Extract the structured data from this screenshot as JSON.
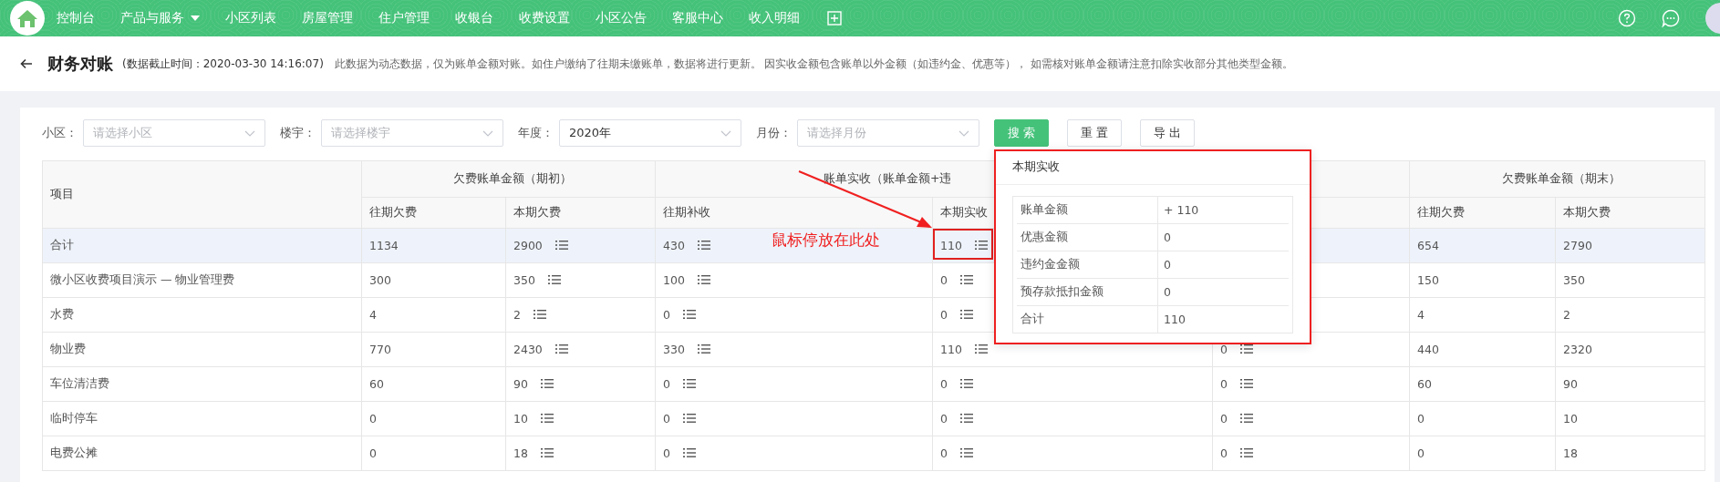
{
  "nav": {
    "items": [
      {
        "label": "控制台",
        "dropdown": false
      },
      {
        "label": "产品与服务",
        "dropdown": true
      },
      {
        "label": "小区列表",
        "dropdown": false
      },
      {
        "label": "房屋管理",
        "dropdown": false
      },
      {
        "label": "住户管理",
        "dropdown": false
      },
      {
        "label": "收银台",
        "dropdown": false
      },
      {
        "label": "收费设置",
        "dropdown": false
      },
      {
        "label": "小区公告",
        "dropdown": false
      },
      {
        "label": "客服中心",
        "dropdown": false
      },
      {
        "label": "收入明细",
        "dropdown": false
      }
    ]
  },
  "header": {
    "title": "财务对账",
    "timestamp": "(数据截止时间：2020-03-30 14:16:07)",
    "note": "此数据为动态数据，仅为账单金额对账。如住户缴纳了往期未缴账单，数据将进行更新。 因实收金额包含账单以外金额（如违约金、优惠等）， 如需核对账单金额请注意扣除实收部分其他类型金额。"
  },
  "filters": [
    {
      "label": "小区：",
      "placeholder": "请选择小区"
    },
    {
      "label": "楼宇：",
      "placeholder": "请选择楼宇"
    },
    {
      "label": "年度：",
      "value": "2020年"
    },
    {
      "label": "月份：",
      "placeholder": "请选择月份"
    }
  ],
  "buttons": [
    {
      "label": "搜 索",
      "kind": "primary"
    },
    {
      "label": "重 置",
      "kind": "default"
    },
    {
      "label": "导 出",
      "kind": "default"
    }
  ],
  "table": {
    "first_column": "项目",
    "groups": [
      {
        "label": "欠费账单金额（期初）",
        "columns": [
          {
            "label": "往期欠费",
            "kind": "plain"
          },
          {
            "label": "本期欠费",
            "kind": "detail"
          }
        ]
      },
      {
        "label": "账单实收（账单金额+违",
        "columns": [
          {
            "label": "往期补收",
            "kind": "detail"
          },
          {
            "label": "本期实收",
            "kind": "detail"
          },
          {
            "kind": "detail"
          }
        ]
      },
      {
        "label": "欠费账单金额（期末）",
        "columns": [
          {
            "label": "往期欠费",
            "kind": "plain"
          },
          {
            "label": "本期欠费",
            "kind": "plain"
          }
        ]
      }
    ],
    "rows": [
      {
        "hovered": true,
        "cells": [
          "合计",
          "1134",
          "2900",
          "430",
          "110",
          null,
          "654",
          "2790"
        ]
      },
      {
        "hovered": false,
        "cells": [
          "微小区收费项目演示 — 物业管理费",
          "300",
          "350",
          "100",
          "0",
          null,
          "150",
          "350"
        ]
      },
      {
        "hovered": false,
        "cells": [
          "水费",
          "4",
          "2",
          "0",
          "0",
          null,
          "4",
          "2"
        ]
      },
      {
        "hovered": false,
        "cells": [
          "物业费",
          "770",
          "2430",
          "330",
          "110",
          "0",
          "440",
          "2320"
        ]
      },
      {
        "hovered": false,
        "cells": [
          "车位清洁费",
          "60",
          "90",
          "0",
          "0",
          "0",
          "60",
          "90"
        ]
      },
      {
        "hovered": false,
        "cells": [
          "临时停车",
          "0",
          "10",
          "0",
          "0",
          "0",
          "0",
          "10"
        ]
      },
      {
        "hovered": false,
        "cells": [
          "电费公摊",
          "0",
          "18",
          "0",
          "0",
          "0",
          "0",
          "18"
        ]
      }
    ]
  },
  "popup": {
    "title": "本期实收",
    "rows": [
      {
        "label": "账单金额",
        "value": "+ 110"
      },
      {
        "label": "优惠金额",
        "value": "0"
      },
      {
        "label": "违约金金额",
        "value": "0"
      },
      {
        "label": "预存款抵扣金额",
        "value": "0"
      },
      {
        "label": "合计",
        "value": "110"
      }
    ]
  },
  "annotation": {
    "text": "鼠标停放在此处"
  }
}
